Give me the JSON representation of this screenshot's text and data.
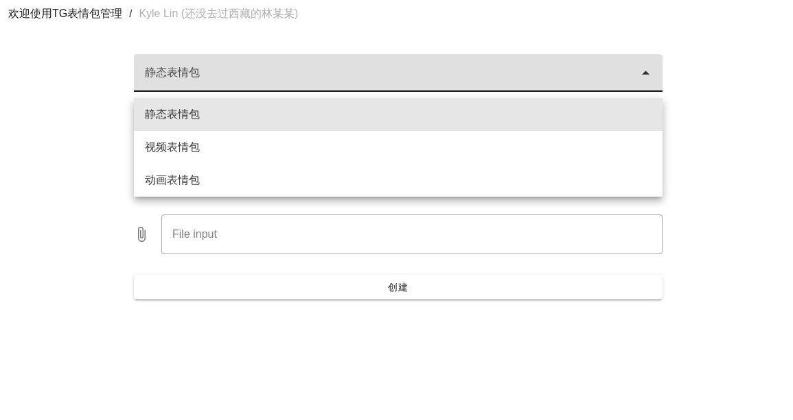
{
  "breadcrumb": {
    "items": [
      {
        "label": "欢迎使用TG表情包管理",
        "disabled": false
      },
      {
        "label": "Kyle Lin (还没去过西藏的林某某)",
        "disabled": true
      }
    ],
    "separator": "/"
  },
  "type_select": {
    "value": "静态表情包",
    "expanded": true,
    "options": [
      {
        "label": "静态表情包",
        "selected": true
      },
      {
        "label": "视频表情包",
        "selected": false
      },
      {
        "label": "动画表情包",
        "selected": false
      }
    ]
  },
  "file_input": {
    "placeholder": "File input"
  },
  "create_button": {
    "label": "创建"
  }
}
